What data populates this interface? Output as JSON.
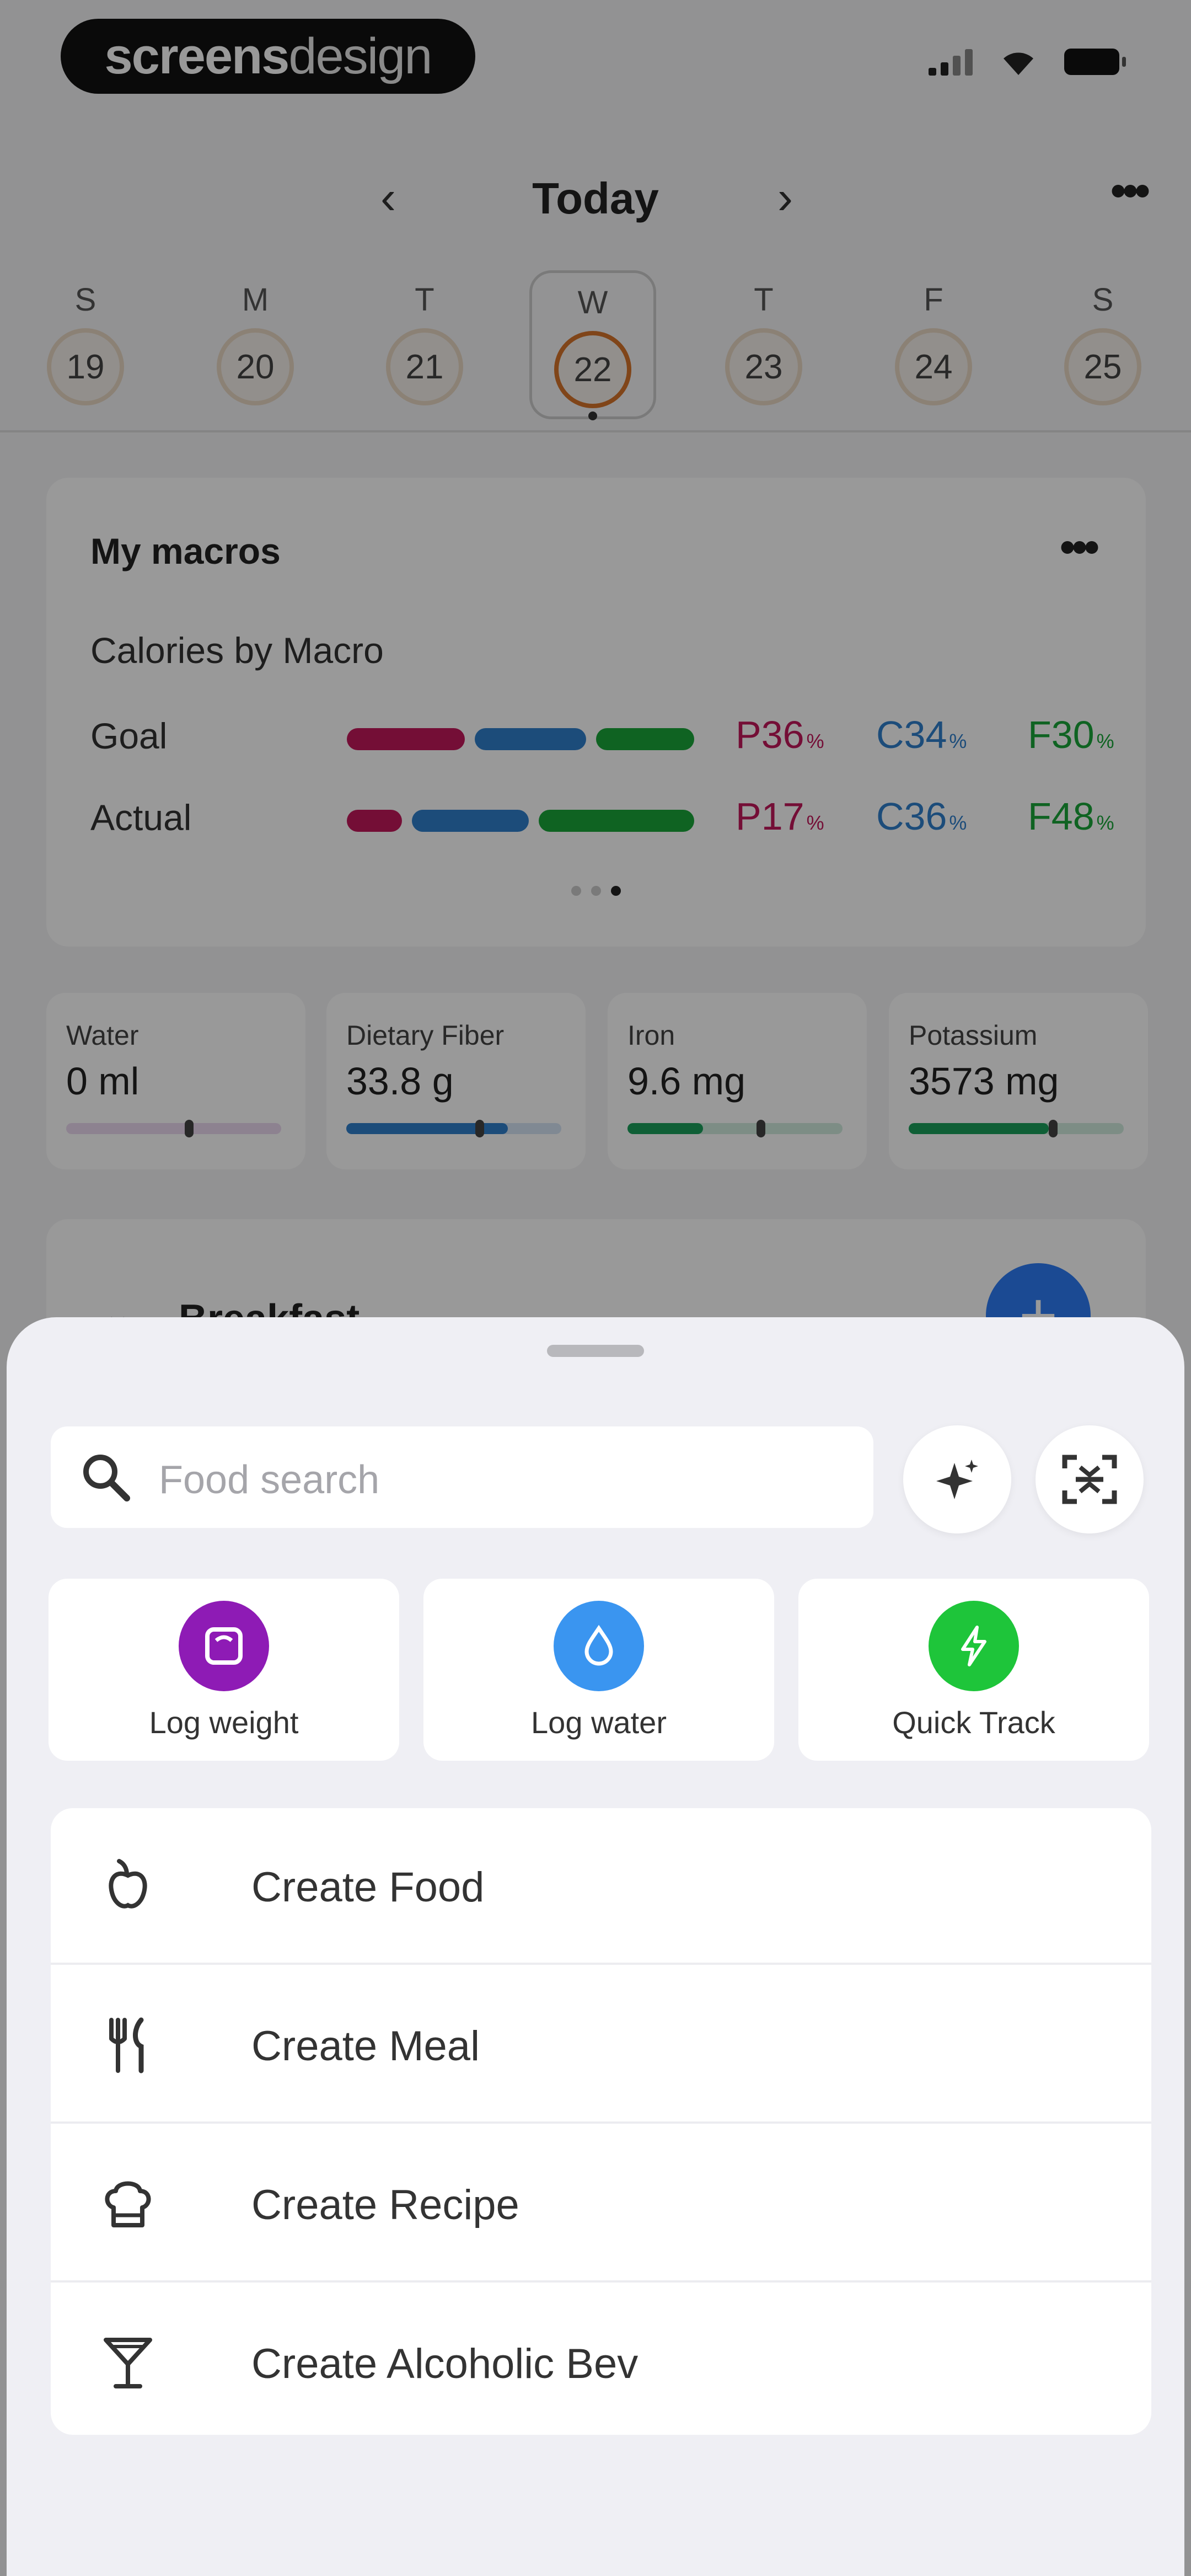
{
  "status_bar": {
    "brand_bold": "screens",
    "brand_light": "design"
  },
  "day_header": {
    "title": "Today",
    "prev_icon": "chevron-left-icon",
    "next_icon": "chevron-right-icon",
    "more_icon": "more-icon"
  },
  "week": [
    {
      "letter": "S",
      "date": "19",
      "selected": false
    },
    {
      "letter": "M",
      "date": "20",
      "selected": false
    },
    {
      "letter": "T",
      "date": "21",
      "selected": false
    },
    {
      "letter": "W",
      "date": "22",
      "selected": true
    },
    {
      "letter": "T",
      "date": "23",
      "selected": false
    },
    {
      "letter": "F",
      "date": "24",
      "selected": false
    },
    {
      "letter": "S",
      "date": "25",
      "selected": false
    }
  ],
  "macros": {
    "title": "My macros",
    "subtitle": "Calories by Macro",
    "colors": {
      "protein": "#c2185b",
      "carbs": "#2f7fcc",
      "fat": "#1aa53a"
    },
    "rows": [
      {
        "label": "Goal",
        "p": "P36",
        "c": "C34",
        "f": "F30",
        "unit": "%",
        "p_frac": 0.36,
        "c_frac": 0.34,
        "f_frac": 0.3
      },
      {
        "label": "Actual",
        "p": "P17",
        "c": "C36",
        "f": "F48",
        "unit": "%",
        "p_frac": 0.17,
        "c_frac": 0.36,
        "f_frac": 0.48
      }
    ],
    "page_count": 3,
    "active_page": 3
  },
  "nutrients": [
    {
      "label": "Water",
      "value": "0 ml",
      "color": "#9c3fb8",
      "fill": 0.0,
      "target": 0.55
    },
    {
      "label": "Dietary Fiber",
      "value": "33.8 g",
      "color": "#2f7fcc",
      "fill": 0.75,
      "target": 0.6
    },
    {
      "label": "Iron",
      "value": "9.6 mg",
      "color": "#1a9e5a",
      "fill": 0.35,
      "target": 0.6
    },
    {
      "label": "Potassium",
      "value": "3573 mg",
      "color": "#1a9e5a",
      "fill": 0.65,
      "target": 0.65
    }
  ],
  "meal": {
    "title": "Breakfast",
    "add_icon": "plus-icon"
  },
  "sheet": {
    "search_placeholder": "Food search",
    "ai_button_icon": "sparkle-icon",
    "scan_button_icon": "barcode-scan-icon",
    "actions": [
      {
        "label": "Log weight",
        "color": "#8e1bb5",
        "icon": "scale-icon"
      },
      {
        "label": "Log water",
        "color": "#3a95f0",
        "icon": "water-drop-icon"
      },
      {
        "label": "Quick Track",
        "color": "#1ec53a",
        "icon": "lightning-icon"
      }
    ],
    "create_items": [
      {
        "label": "Create Food",
        "icon": "apple-icon"
      },
      {
        "label": "Create Meal",
        "icon": "fork-knife-icon"
      },
      {
        "label": "Create Recipe",
        "icon": "chef-hat-icon"
      },
      {
        "label": "Create Alcoholic Bev",
        "icon": "cocktail-glass-icon"
      }
    ]
  }
}
